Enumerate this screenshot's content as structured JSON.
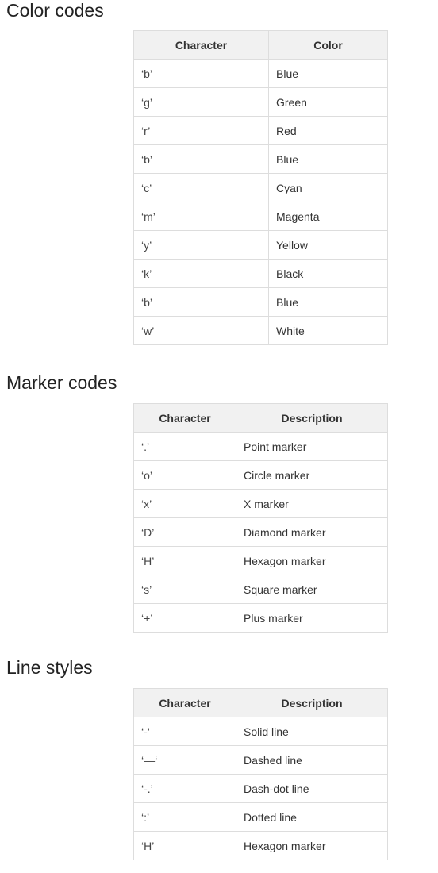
{
  "color_section": {
    "title": "Color codes",
    "headers": [
      "Character",
      "Color"
    ],
    "rows": [
      [
        "‘b’",
        "Blue"
      ],
      [
        "‘g’",
        "Green"
      ],
      [
        "‘r’",
        "Red"
      ],
      [
        "‘b’",
        "Blue"
      ],
      [
        "‘c’",
        "Cyan"
      ],
      [
        "‘m’",
        "Magenta"
      ],
      [
        "‘y’",
        "Yellow"
      ],
      [
        "‘k’",
        "Black"
      ],
      [
        "‘b’",
        "Blue"
      ],
      [
        "‘w’",
        "White"
      ]
    ]
  },
  "marker_section": {
    "title": "Marker codes",
    "headers": [
      "Character",
      "Description"
    ],
    "rows": [
      [
        "‘.’",
        "Point marker"
      ],
      [
        "‘o’",
        "Circle marker"
      ],
      [
        "‘x’",
        "X marker"
      ],
      [
        "‘D’",
        "Diamond marker"
      ],
      [
        "‘H’",
        "Hexagon marker"
      ],
      [
        "‘s’",
        "Square marker"
      ],
      [
        "‘+’",
        "Plus marker"
      ]
    ]
  },
  "line_section": {
    "title": "Line styles",
    "headers": [
      "Character",
      "Description"
    ],
    "rows": [
      [
        "‘-‘",
        "Solid line"
      ],
      [
        "‘—‘",
        "Dashed line"
      ],
      [
        "‘-.’",
        "Dash-dot line"
      ],
      [
        "‘:’",
        "Dotted line"
      ],
      [
        "‘H’",
        "Hexagon marker"
      ]
    ]
  }
}
